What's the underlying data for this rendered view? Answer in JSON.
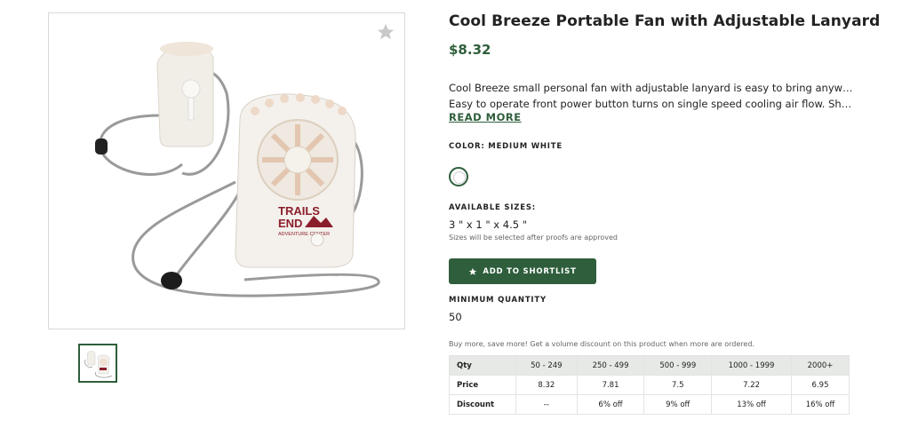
{
  "product": {
    "title": "Cool Breeze Portable Fan with Adjustable Lanyard",
    "price": "$8.32",
    "description": [
      "Cool Breeze small personal fan with adjustable lanyard is easy to bring anywhere",
      "Easy to operate front power button turns on single speed cooling air flow. Showcase…"
    ],
    "read_more": "READ MORE",
    "imprint_text": [
      "TRAILS",
      "END",
      "ADVENTURE CENTER"
    ]
  },
  "color": {
    "label": "COLOR: MEDIUM WHITE",
    "swatch_color": "#ffffff"
  },
  "sizes": {
    "label": "AVAILABLE SIZES:",
    "value": "3 \" x 1 \" x 4.5 \"",
    "note": "Sizes will be selected after proofs are approved"
  },
  "shortlist_button": {
    "label": "ADD TO SHORTLIST",
    "icon": "star-icon"
  },
  "minimum": {
    "label": "MINIMUM QUANTITY",
    "value": "50"
  },
  "volume_note": "Buy more, save more! Get a volume discount on this product when more are ordered.",
  "pricing_table": {
    "headers": [
      "Qty",
      "50 - 249",
      "250 - 499",
      "500 - 999",
      "1000 - 1999",
      "2000+"
    ],
    "rows": [
      [
        "Price",
        "8.32",
        "7.81",
        "7.5",
        "7.22",
        "6.95"
      ],
      [
        "Discount",
        "--",
        "6% off",
        "9% off",
        "13% off",
        "16% off"
      ]
    ]
  },
  "colors": {
    "accent": "#2e5e3b",
    "imprint": "#8b1e2b",
    "table_header_bg": "#e6e9e6"
  },
  "icons": {
    "favorite": "star-outline-icon"
  }
}
